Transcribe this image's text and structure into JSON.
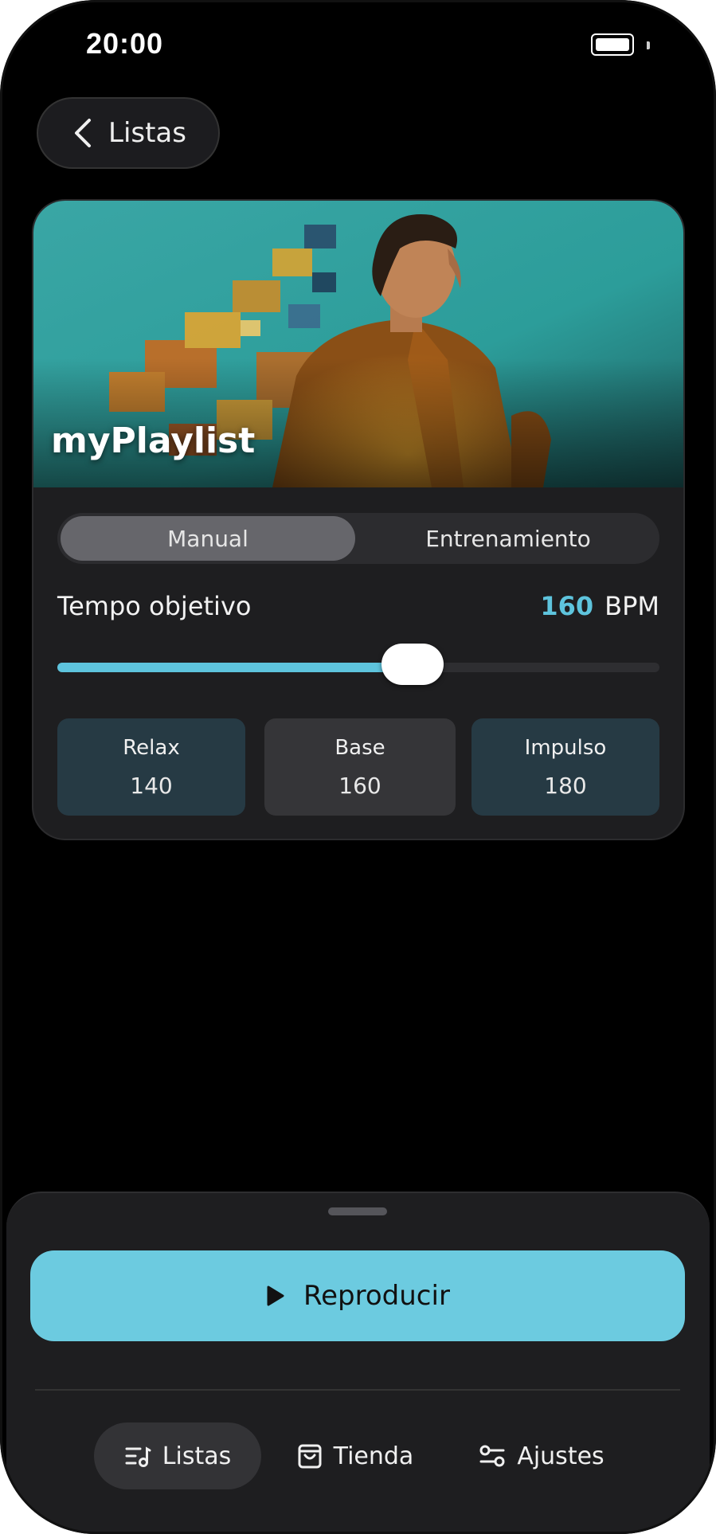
{
  "status_bar": {
    "time": "20:00"
  },
  "back_button": {
    "label": "Listas"
  },
  "playlist": {
    "title": "myPlaylist"
  },
  "mode_selector": {
    "options": [
      "Manual",
      "Entrenamiento"
    ],
    "selected": "Manual"
  },
  "tempo": {
    "label": "Tempo objetivo",
    "value": "160",
    "unit": "BPM",
    "slider_fraction": 0.59
  },
  "presets": [
    {
      "name": "Relax",
      "value": "140"
    },
    {
      "name": "Base",
      "value": "160"
    },
    {
      "name": "Impulso",
      "value": "180"
    }
  ],
  "player": {
    "play_label": "Reproducir"
  },
  "bottom_nav": {
    "items": [
      {
        "label": "Listas",
        "icon": "playlist-icon",
        "active": true
      },
      {
        "label": "Tienda",
        "icon": "bag-icon",
        "active": false
      },
      {
        "label": "Ajustes",
        "icon": "sliders-icon",
        "active": false
      }
    ]
  },
  "colors": {
    "accent": "#5ec4dd",
    "play_button": "#6ccbe0",
    "background": "#000000",
    "card": "#1e1e20"
  }
}
